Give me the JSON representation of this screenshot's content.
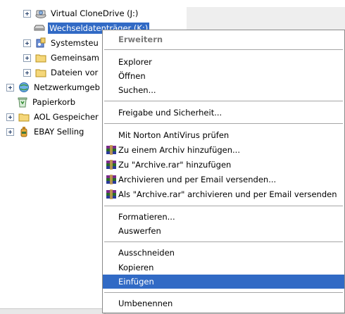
{
  "tree": {
    "items": [
      {
        "label": "Virtual CloneDrive (J:)",
        "icon": "cd-drive-icon",
        "expandable": true
      },
      {
        "label": "Wechseldatenträger (K:)",
        "icon": "removable-drive-icon",
        "expandable": false,
        "selected": true
      },
      {
        "label": "Systemsteu",
        "icon": "control-panel-icon",
        "expandable": true
      },
      {
        "label": "Gemeinsam",
        "icon": "folder-icon",
        "expandable": true
      },
      {
        "label": "Dateien vor",
        "icon": "folder-icon",
        "expandable": true
      },
      {
        "label": "Netzwerkumgeb",
        "icon": "network-icon",
        "expandable": true
      },
      {
        "label": "Papierkorb",
        "icon": "recycle-bin-icon",
        "expandable": false
      },
      {
        "label": "AOL Gespeicher",
        "icon": "folder-icon",
        "expandable": true
      },
      {
        "label": "EBAY Selling",
        "icon": "bottle-icon",
        "expandable": true
      }
    ]
  },
  "menu": {
    "items": [
      {
        "label": "Erweitern",
        "bold": true
      },
      {
        "label": "Explorer"
      },
      {
        "label": "Öffnen"
      },
      {
        "label": "Suchen..."
      },
      {
        "label": "Freigabe und Sicherheit..."
      },
      {
        "label": "Mit Norton AntiVirus prüfen"
      },
      {
        "label": "Zu einem Archiv hinzufügen...",
        "icon": "winrar-icon"
      },
      {
        "label": "Zu \"Archive.rar\" hinzufügen",
        "icon": "winrar-icon"
      },
      {
        "label": "Archivieren und per Email versenden...",
        "icon": "winrar-icon"
      },
      {
        "label": "Als \"Archive.rar\" archivieren und per Email versenden",
        "icon": "winrar-icon"
      },
      {
        "label": "Formatieren..."
      },
      {
        "label": "Auswerfen"
      },
      {
        "label": "Ausschneiden"
      },
      {
        "label": "Kopieren"
      },
      {
        "label": "Einfügen",
        "highlighted": true
      },
      {
        "label": "Umbenennen"
      }
    ]
  },
  "colors": {
    "selection": "#316ac5",
    "menu_border": "#8a8a8a",
    "disabled_bold": "#7a7a7a"
  }
}
